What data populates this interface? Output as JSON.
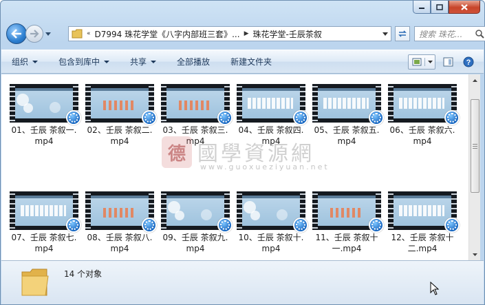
{
  "address_bar": {
    "overflow": "«",
    "path_part1": "D7994 珠花学堂《八字内部班三套》...",
    "path_part2": "珠花学堂-壬辰茶叙"
  },
  "search": {
    "placeholder": "搜索 珠花..."
  },
  "toolbar": {
    "items": [
      "组织",
      "包含到库中",
      "共享",
      "全部播放",
      "新建文件夹"
    ]
  },
  "files": [
    {
      "name": "01、壬辰 茶叙一.mp4",
      "style": "flowers"
    },
    {
      "name": "02、壬辰 茶叙二.mp4",
      "style": "dots"
    },
    {
      "name": "03、壬辰 茶叙三.mp4",
      "style": "dots"
    },
    {
      "name": "04、壬辰 茶叙四.mp4",
      "style": "table"
    },
    {
      "name": "05、壬辰 茶叙五.mp4",
      "style": "table"
    },
    {
      "name": "06、壬辰 茶叙六.mp4",
      "style": "table"
    },
    {
      "name": "07、壬辰 茶叙七.mp4",
      "style": "table"
    },
    {
      "name": "08、壬辰 茶叙八.mp4",
      "style": "dots"
    },
    {
      "name": "09、壬辰 茶叙九.mp4",
      "style": "flowers"
    },
    {
      "name": "10、壬辰 茶叙十.mp4",
      "style": "flowers"
    },
    {
      "name": "11、壬辰 茶叙十一.mp4",
      "style": "dots"
    },
    {
      "name": "12、壬辰 茶叙十二.mp4",
      "style": "table"
    }
  ],
  "watermark": {
    "seal": "德",
    "text": "國學資源網",
    "url": "www.guoxueziyuan.net"
  },
  "details": {
    "count": "14 个对象"
  }
}
